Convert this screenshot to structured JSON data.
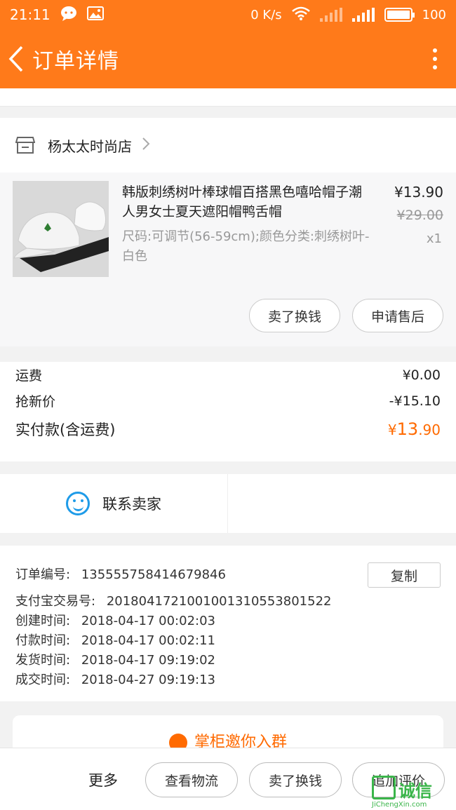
{
  "statusbar": {
    "time": "21:11",
    "net_speed": "0 K/s",
    "battery": "100",
    "battery_level": 1.0
  },
  "header": {
    "title": "订单详情"
  },
  "shop": {
    "name": "杨太太时尚店"
  },
  "product": {
    "title": "韩版刺绣树叶棒球帽百搭黑色嘻哈帽子潮人男女士夏天遮阳帽鸭舌帽",
    "spec": "尺码:可调节(56-59cm);颜色分类:刺绣树叶-白色",
    "price": "¥13.90",
    "old_price": "¥29.00",
    "qty": "x1",
    "btn_sell": "卖了换钱",
    "btn_aftersale": "申请售后"
  },
  "fees": {
    "shipping_label": "运费",
    "shipping_value": "¥0.00",
    "discount_label": "抢新价",
    "discount_value": "-¥15.10",
    "total_label": "实付款(含运费)",
    "total_currency": "¥",
    "total_int": "13",
    "total_dec": ".90"
  },
  "contact": {
    "label": "联系卖家"
  },
  "order": {
    "no_label": "订单编号:",
    "no_value": "1355557584146798​46",
    "copy": "复制",
    "alipay_label": "支付宝交易号:",
    "alipay_value": "2018041721001001310553801522",
    "created_label": "创建时间:",
    "created_value": "2018-04-17 00:02:03",
    "paid_label": "付款时间:",
    "paid_value": "2018-04-17 00:02:11",
    "shipped_label": "发货时间:",
    "shipped_value": "2018-04-17 09:19:02",
    "done_label": "成交时间:",
    "done_value": "2018-04-27 09:19:13"
  },
  "invite": {
    "text": "掌柜邀你入群"
  },
  "bottom": {
    "more": "更多",
    "logistics": "查看物流",
    "sell": "卖了换钱",
    "review": "追加评价"
  },
  "watermark": {
    "name": "诚信",
    "url": "JiChengXin.com"
  },
  "colors": {
    "brand": "#ff7a1a",
    "price": "#ff6a00",
    "contact": "#1e9be8"
  }
}
